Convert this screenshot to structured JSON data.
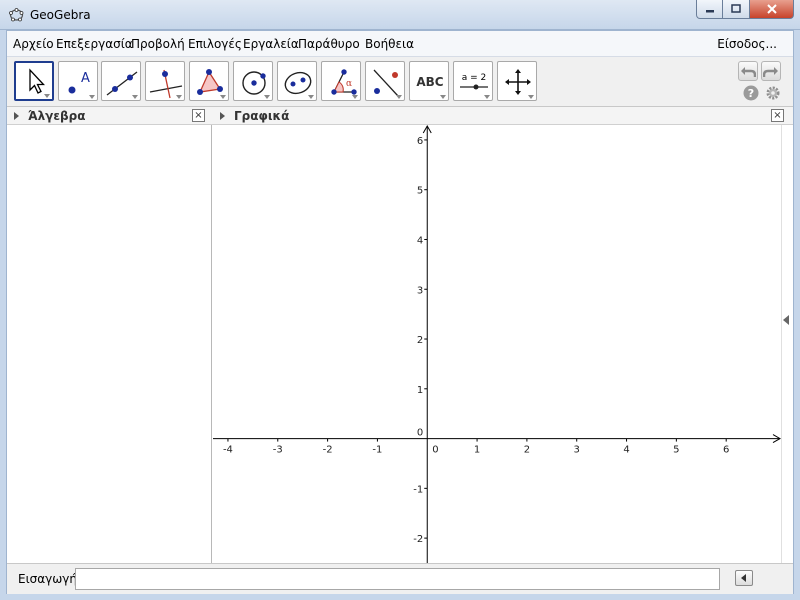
{
  "window": {
    "title": "GeoGebra",
    "icon": "geogebra-ellipse-icon"
  },
  "menu": {
    "items": [
      "Αρχείο",
      "Επεξεργασία",
      "Προβολή",
      "Επιλογές",
      "Εργαλεία",
      "Παράθυρο",
      "Βοήθεια"
    ],
    "signin": "Είσοδος..."
  },
  "toolbar": {
    "tools": [
      {
        "name": "move-tool",
        "icon": "cursor-arrow-icon",
        "active": true
      },
      {
        "name": "point-tool",
        "icon": "point-icon",
        "active": false
      },
      {
        "name": "line-tool",
        "icon": "line-icon",
        "active": false
      },
      {
        "name": "perpendicular-line-tool",
        "icon": "perpendicular-line-icon",
        "active": false
      },
      {
        "name": "polygon-tool",
        "icon": "polygon-icon",
        "active": false
      },
      {
        "name": "circle-tool",
        "icon": "circle-icon",
        "active": false
      },
      {
        "name": "ellipse-tool",
        "icon": "ellipse-icon",
        "active": false
      },
      {
        "name": "angle-tool",
        "icon": "angle-icon",
        "active": false
      },
      {
        "name": "reflect-tool",
        "icon": "reflect-about-line-icon",
        "active": false
      },
      {
        "name": "text-tool",
        "icon": "text-icon",
        "active": false
      },
      {
        "name": "slider-tool",
        "icon": "slider-icon",
        "active": false
      },
      {
        "name": "move-graphics-view-tool",
        "icon": "move-arrows-icon",
        "active": false
      }
    ],
    "text_tool_label": "ABC",
    "slider_tool_label": "a = 2"
  },
  "algebra_view": {
    "title": "Άλγεβρα"
  },
  "graphics_view": {
    "title": "Γραφικά",
    "axes": {
      "x_ticks": [
        "-4",
        "-3",
        "-2",
        "-1",
        "0",
        "1",
        "2",
        "3",
        "4",
        "5",
        "6"
      ],
      "y_ticks": [
        "6",
        "5",
        "4",
        "3",
        "2",
        "1",
        "0",
        "-1",
        "-2"
      ],
      "xlim": [
        -4.3,
        7.1
      ],
      "ylim": [
        -2.5,
        6.3
      ],
      "grid": false
    }
  },
  "input_bar": {
    "label": "Εισαγωγή:",
    "value": ""
  }
}
